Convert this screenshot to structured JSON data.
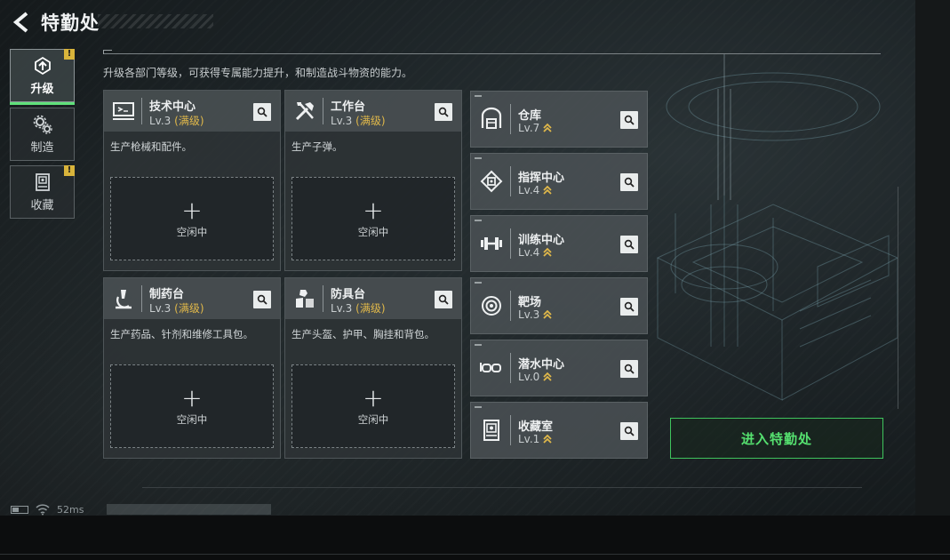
{
  "header": {
    "title": "特勤处"
  },
  "sidebar": {
    "tabs": [
      {
        "label": "升级",
        "active": true,
        "alert": "!"
      },
      {
        "label": "制造",
        "active": false,
        "alert": ""
      },
      {
        "label": "收藏",
        "active": false,
        "alert": "!"
      }
    ]
  },
  "description": "升级各部门等级，可获得专属能力提升，和制造战斗物资的能力。",
  "workstations": [
    {
      "name": "技术中心",
      "level": "Lv.3",
      "level_note": "(满级)",
      "desc": "生产枪械和配件。",
      "slot_label": "空闲中",
      "icon": "computer-icon"
    },
    {
      "name": "工作台",
      "level": "Lv.3",
      "level_note": "(满级)",
      "desc": "生产子弹。",
      "slot_label": "空闲中",
      "icon": "tools-icon"
    },
    {
      "name": "制药台",
      "level": "Lv.3",
      "level_note": "(满级)",
      "desc": "生产药品、针剂和维修工具包。",
      "slot_label": "空闲中",
      "icon": "microscope-icon"
    },
    {
      "name": "防具台",
      "level": "Lv.3",
      "level_note": "(满级)",
      "desc": "生产头盔、护甲、胸挂和背包。",
      "slot_label": "空闲中",
      "icon": "armor-icon"
    }
  ],
  "facilities": [
    {
      "name": "仓库",
      "level": "Lv.7",
      "icon": "warehouse-icon"
    },
    {
      "name": "指挥中心",
      "level": "Lv.4",
      "icon": "chip-icon"
    },
    {
      "name": "训练中心",
      "level": "Lv.4",
      "icon": "dumbbell-icon"
    },
    {
      "name": "靶场",
      "level": "Lv.3",
      "icon": "target-icon"
    },
    {
      "name": "潜水中心",
      "level": "Lv.0",
      "icon": "goggles-icon"
    },
    {
      "name": "收藏室",
      "level": "Lv.1",
      "icon": "display-case-icon"
    }
  ],
  "enter_button": "进入特勤处",
  "status": {
    "ping": "52ms"
  },
  "colors": {
    "accent_green": "#55e06f",
    "gold": "#e0b84a",
    "alert_yellow": "#d9b43b"
  }
}
